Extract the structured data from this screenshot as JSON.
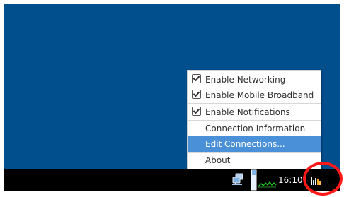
{
  "menu": {
    "items": [
      {
        "label": "Enable Networking",
        "checked": true
      },
      {
        "label": "Enable Mobile Broadband",
        "checked": true
      },
      {
        "label": "Enable Notifications",
        "checked": true
      },
      {
        "label": "Connection Information",
        "checked": false
      },
      {
        "label": "Edit Connections...",
        "checked": false,
        "highlighted": true
      },
      {
        "label": "About",
        "checked": false
      }
    ]
  },
  "taskbar": {
    "clock": "16:10",
    "icons": [
      "network-wired-icon",
      "battery-icon",
      "cpu-graph-icon",
      "signal-icon"
    ]
  },
  "colors": {
    "wallpaper": "#024F8D",
    "taskbar": "#000000",
    "menu_highlight": "#4A90D9",
    "annotation_ring": "#ff1a1a"
  }
}
